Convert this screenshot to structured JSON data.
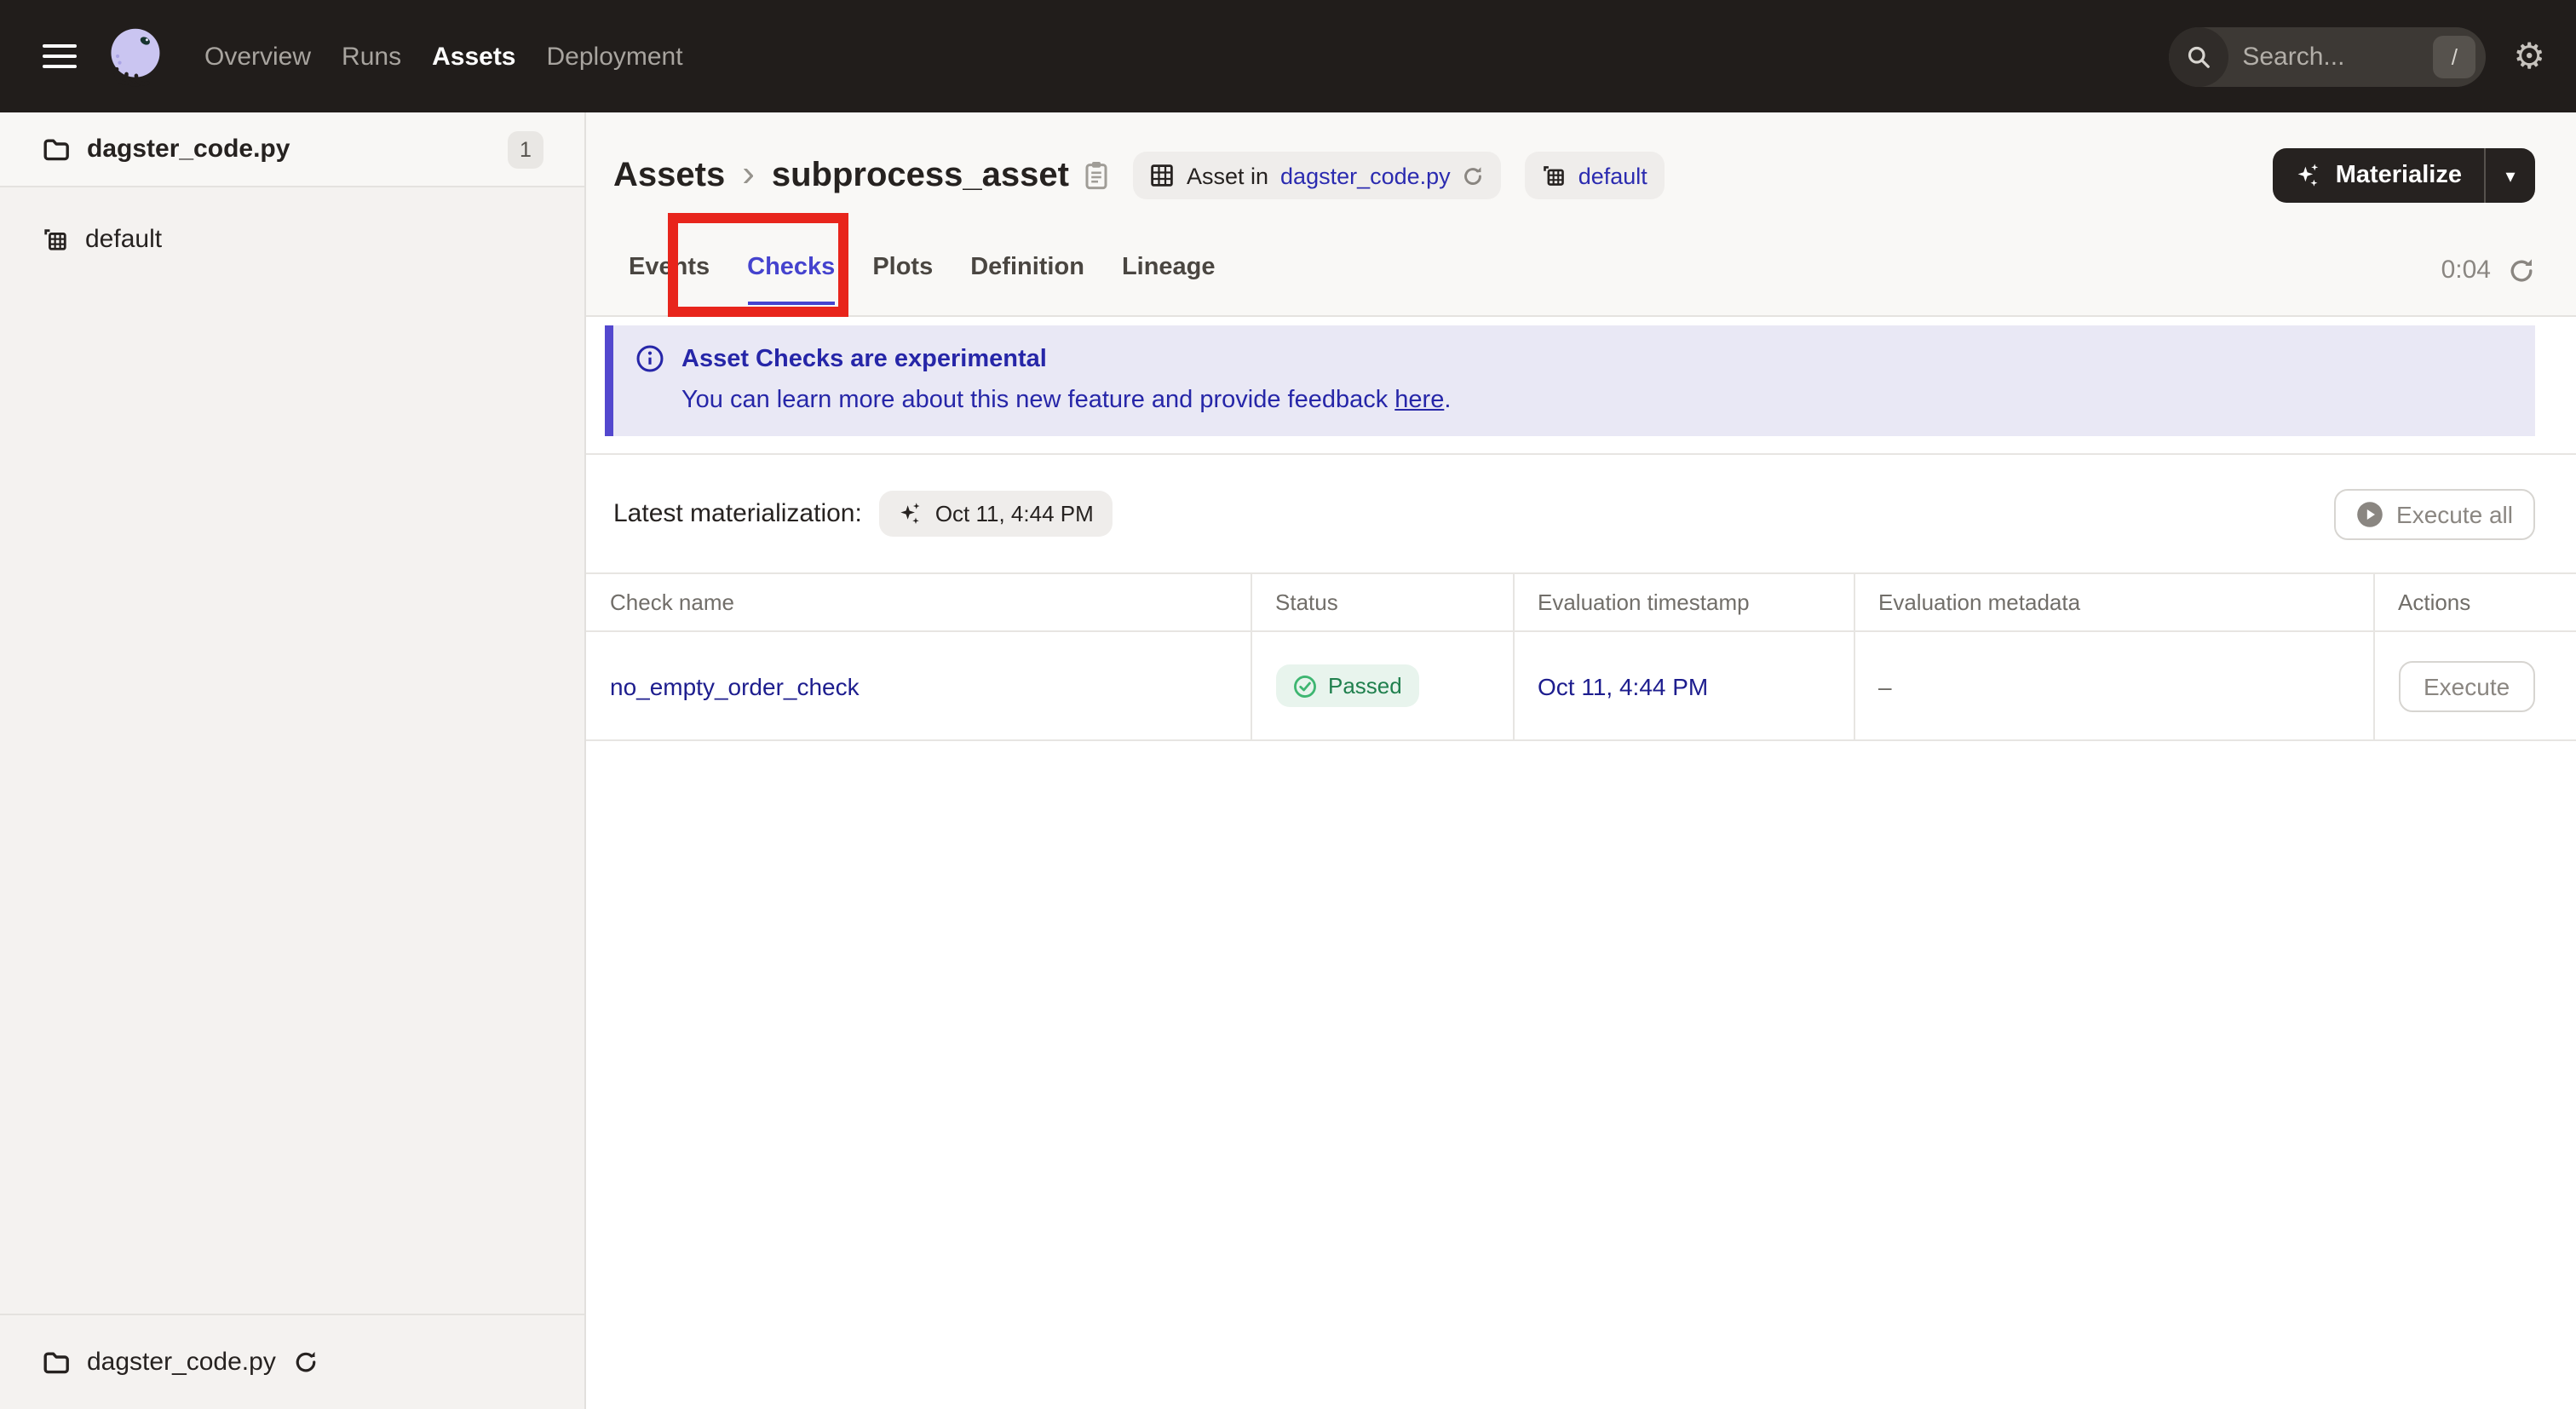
{
  "topnav": {
    "nav_items": [
      {
        "label": "Overview"
      },
      {
        "label": "Runs"
      },
      {
        "label": "Assets"
      },
      {
        "label": "Deployment"
      }
    ],
    "search": {
      "placeholder": "Search...",
      "shortcut": "/"
    }
  },
  "glyphs": {
    "gear": "⚙",
    "caret_down": "▾",
    "breadcrumb_chevron": "›"
  },
  "sidebar": {
    "top_item": {
      "label": "dagster_code.py",
      "count": "1"
    },
    "group_item": {
      "label": "default"
    },
    "bottom_item": {
      "label": "dagster_code.py"
    }
  },
  "header": {
    "breadcrumb_root": "Assets",
    "asset_name": "subprocess_asset",
    "asset_chip": {
      "prefix": "Asset in",
      "link": "dagster_code.py"
    },
    "group_chip": {
      "label": "default"
    },
    "materialize_label": "Materialize"
  },
  "tabs": {
    "items": [
      {
        "label": "Events"
      },
      {
        "label": "Checks"
      },
      {
        "label": "Plots"
      },
      {
        "label": "Definition"
      },
      {
        "label": "Lineage"
      }
    ],
    "active": "Checks",
    "timer": "0:04"
  },
  "banner": {
    "title": "Asset Checks are experimental",
    "body": "You can learn more about this new feature and provide feedback ",
    "link": "here",
    "period": "."
  },
  "latest": {
    "label": "Latest materialization:",
    "chip": "Oct 11, 4:44 PM",
    "execute_all": "Execute all"
  },
  "table": {
    "columns": [
      "Check name",
      "Status",
      "Evaluation timestamp",
      "Evaluation metadata",
      "Actions"
    ],
    "rows": [
      {
        "name": "no_empty_order_check",
        "status": "Passed",
        "timestamp": "Oct 11, 4:44 PM",
        "metadata": "–",
        "action": "Execute"
      }
    ]
  },
  "colors": {
    "topnav_bg": "#211d1b",
    "accent_indigo": "#4543ce",
    "link_blue": "#2b2bb0",
    "table_link": "#1d1d8e",
    "banner_text": "#2626a8",
    "banner_bg": "#e9e8f5",
    "banner_border": "#5348ce",
    "status_green_text": "#20804e",
    "status_green_bg": "#e8f4ed",
    "status_green_icon": "#3eb671",
    "annotation_red": "#e8251c"
  }
}
